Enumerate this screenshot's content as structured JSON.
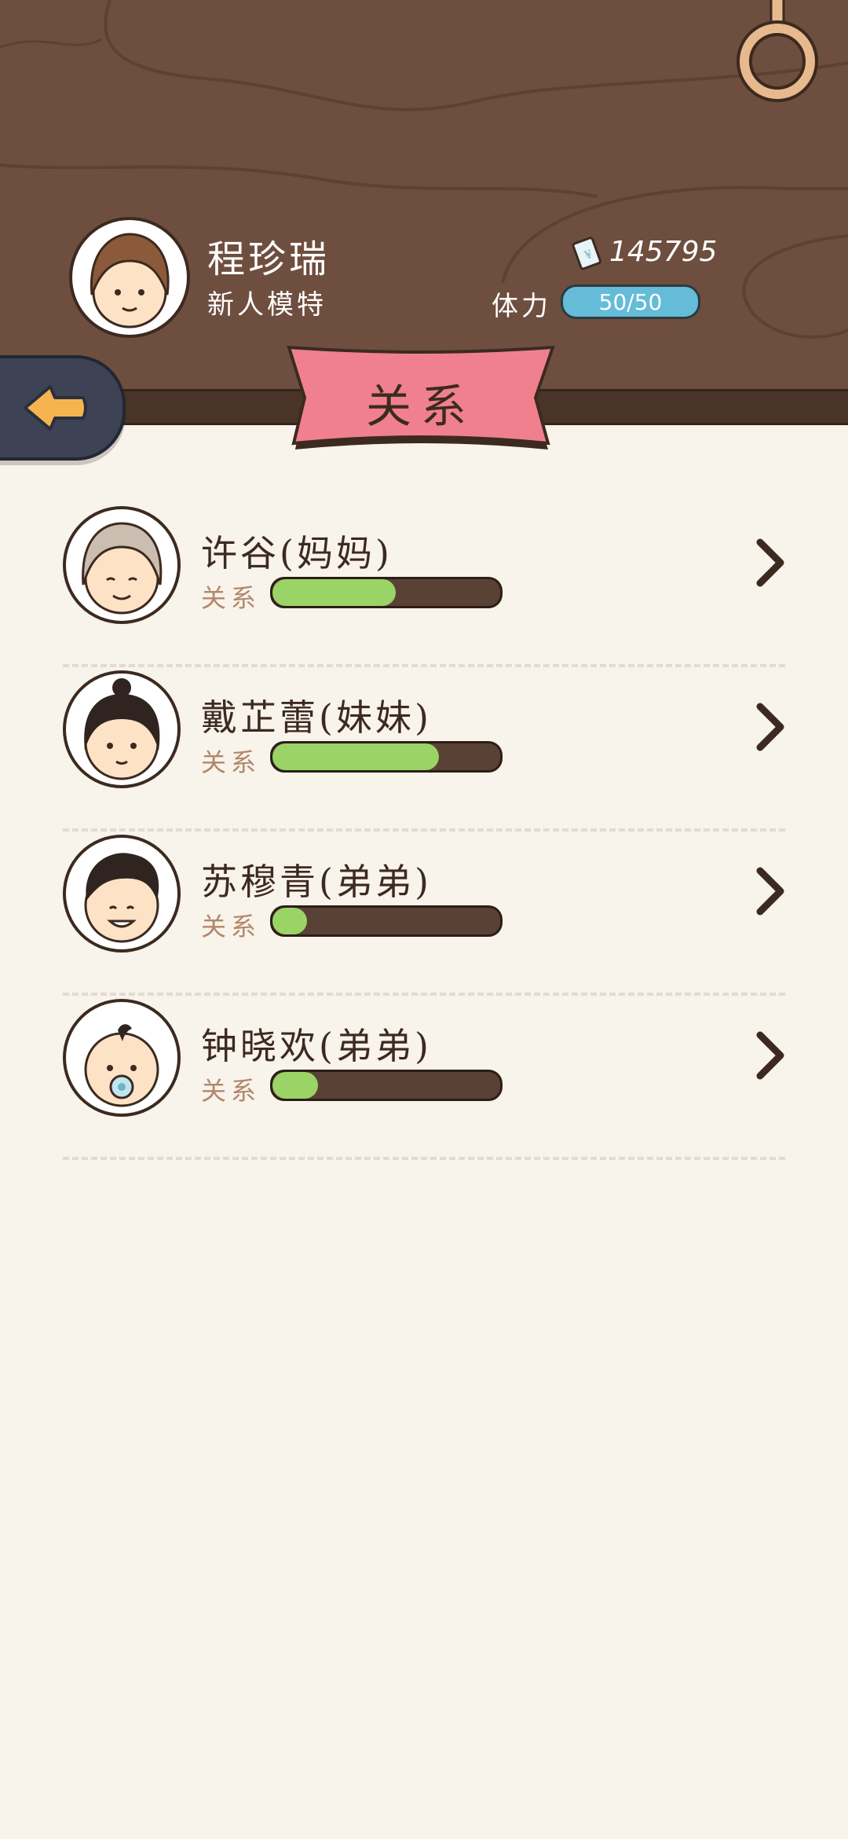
{
  "player": {
    "name": "程珍瑞",
    "title": "新人模特",
    "money": "145795",
    "stamina_label": "体力",
    "stamina_value": "50/50"
  },
  "banner": {
    "title": "关系"
  },
  "relations": [
    {
      "name": "许谷(妈妈)",
      "label": "关系",
      "level": 0.54,
      "avatar": "grandma-face-icon"
    },
    {
      "name": "戴芷蕾(妹妹)",
      "label": "关系",
      "level": 0.73,
      "avatar": "girl-bun-face-icon"
    },
    {
      "name": "苏穆青(弟弟)",
      "label": "关系",
      "level": 0.15,
      "avatar": "boy-face-icon"
    },
    {
      "name": "钟晓欢(弟弟)",
      "label": "关系",
      "level": 0.2,
      "avatar": "baby-face-icon"
    }
  ],
  "colors": {
    "header_wood": "#6e4e3f",
    "banner_pink": "#f0808e",
    "bar_fill": "#9ad466",
    "stamina_blue": "#64bcd8",
    "background": "#f8f3eb"
  },
  "icons": {
    "back": "arrow-left-icon",
    "money": "banknote-icon",
    "chevron": "chevron-right-icon",
    "ring": "hanging-ring-icon"
  }
}
